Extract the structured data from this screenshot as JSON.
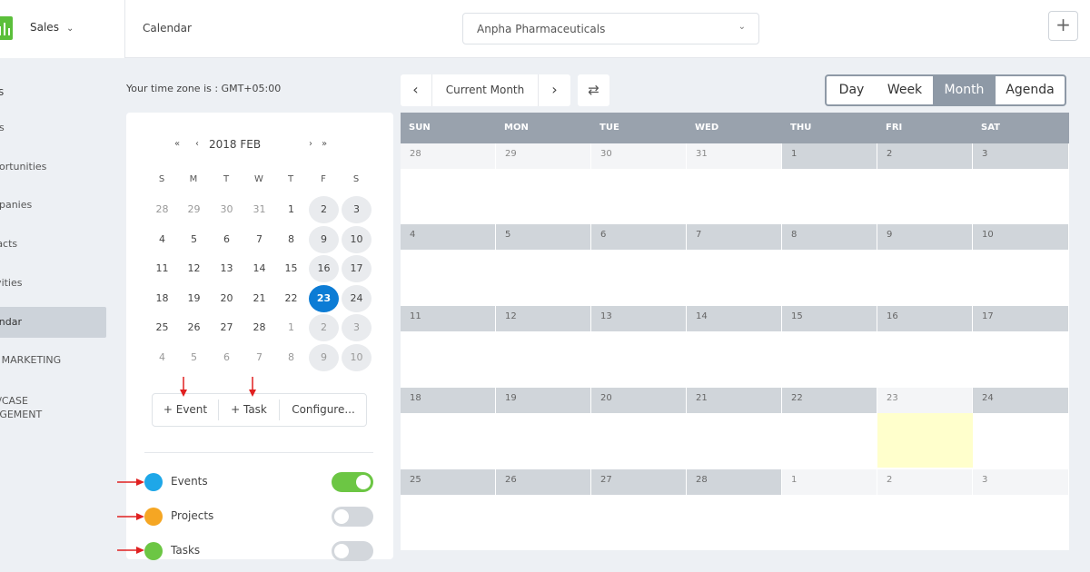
{
  "app": {
    "switcher_label": "Sales",
    "page_title": "Calendar"
  },
  "company_select": {
    "value": "Anpha Pharmaceuticals"
  },
  "sidebar": {
    "heading": "s",
    "items": [
      {
        "label": "ds"
      },
      {
        "label": "portunities"
      },
      {
        "label": "npanies"
      },
      {
        "label": "tacts"
      },
      {
        "label": "ivities"
      },
      {
        "label": "endar"
      },
      {
        "label": "L MARKETING"
      },
      {
        "label_line1": "L/CASE",
        "label_line2": "AGEMENT"
      }
    ]
  },
  "timezone_text": "Your time zone is : GMT+05:00",
  "mini_calendar": {
    "nav_first": "«",
    "nav_prev": "‹",
    "title": "2018 FEB",
    "nav_next": "›",
    "nav_last": "»",
    "weekdays": [
      "S",
      "M",
      "T",
      "W",
      "T",
      "F",
      "S"
    ],
    "weeks": [
      [
        "28",
        "29",
        "30",
        "31",
        "1",
        "2",
        "3"
      ],
      [
        "4",
        "5",
        "6",
        "7",
        "8",
        "9",
        "10"
      ],
      [
        "11",
        "12",
        "13",
        "14",
        "15",
        "16",
        "17"
      ],
      [
        "18",
        "19",
        "20",
        "21",
        "22",
        "23",
        "24"
      ],
      [
        "25",
        "26",
        "27",
        "28",
        "1",
        "2",
        "3"
      ],
      [
        "4",
        "5",
        "6",
        "7",
        "8",
        "9",
        "10"
      ]
    ],
    "today": "23"
  },
  "actions": {
    "event": "+ Event",
    "task": "+ Task",
    "configure": "Configure..."
  },
  "legend": [
    {
      "label": "Events",
      "color": "#1ea7e8",
      "enabled": true
    },
    {
      "label": "Projects",
      "color": "#f5a623",
      "enabled": false
    },
    {
      "label": "Tasks",
      "color": "#6cc644",
      "enabled": false
    }
  ],
  "toolbar": {
    "prev_icon": "chevron-left-icon",
    "current_label": "Current Month",
    "next_icon": "chevron-right-icon",
    "refresh_icon": "refresh-icon"
  },
  "views": [
    "Day",
    "Week",
    "Month",
    "Agenda"
  ],
  "active_view": "Month",
  "calendar": {
    "weekdays": [
      "SUN",
      "MON",
      "TUE",
      "WED",
      "THU",
      "FRI",
      "SAT"
    ],
    "weeks": [
      [
        "28",
        "29",
        "30",
        "31",
        "1",
        "2",
        "3"
      ],
      [
        "4",
        "5",
        "6",
        "7",
        "8",
        "9",
        "10"
      ],
      [
        "11",
        "12",
        "13",
        "14",
        "15",
        "16",
        "17"
      ],
      [
        "18",
        "19",
        "20",
        "21",
        "22",
        "23",
        "24"
      ],
      [
        "25",
        "26",
        "27",
        "28",
        "1",
        "2",
        "3"
      ]
    ],
    "today": "23"
  },
  "colors": {
    "brand": "#5bbf3b",
    "today_circle": "#0c7cd5",
    "today_cell": "#ffffcc",
    "header": "#99a2ad",
    "toggle_on": "#6cc644",
    "toggle_off": "#d3d7dc",
    "annotation_arrow": "#e02020"
  }
}
